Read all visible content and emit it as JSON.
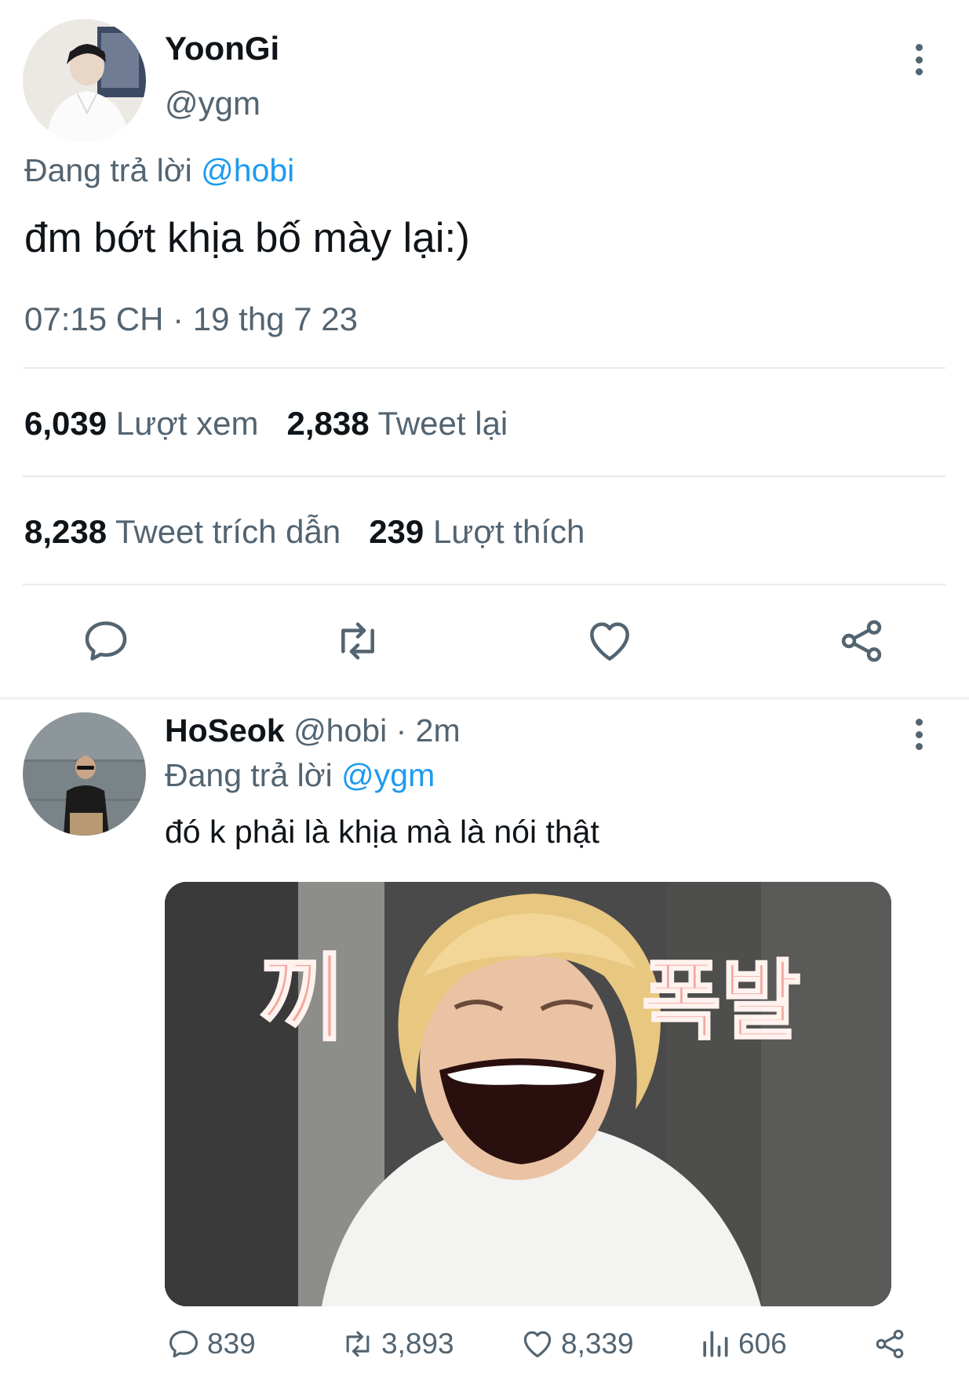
{
  "main_tweet": {
    "display_name": "YoonGi",
    "handle": "@ygm",
    "replying_to_prefix": "Đang trả lời",
    "replying_to_handle": "@hobi",
    "text": "đm bớt khịa bố mày lại:)",
    "timestamp": "07:15 CH · 19 thg 7 23",
    "stats": {
      "views_count": "6,039",
      "views_label": "Lượt xem",
      "retweets_count": "2,838",
      "retweets_label": "Tweet lại",
      "quotes_count": "8,238",
      "quotes_label": "Tweet trích dẫn",
      "likes_count": "239",
      "likes_label": "Lượt thích"
    },
    "actions": [
      "reply-icon",
      "retweet-icon",
      "like-icon",
      "share-icon"
    ]
  },
  "reply_tweet": {
    "display_name": "HoSeok",
    "handle": "@hobi",
    "time_ago": "· 2m",
    "replying_to_prefix": "Đang trả lời",
    "replying_to_handle": "@ygm",
    "text": "đó k phải là khịa mà là nói thật",
    "media": {
      "sign_left": "끼",
      "sign_right": "폭발"
    },
    "actions": {
      "replies": "839",
      "retweets": "3,893",
      "likes": "8,339",
      "views": "606"
    }
  },
  "colors": {
    "accent": "#1d9bf0",
    "text_primary": "#0f1419",
    "text_secondary": "#536471",
    "divider": "#e6ecf0"
  }
}
